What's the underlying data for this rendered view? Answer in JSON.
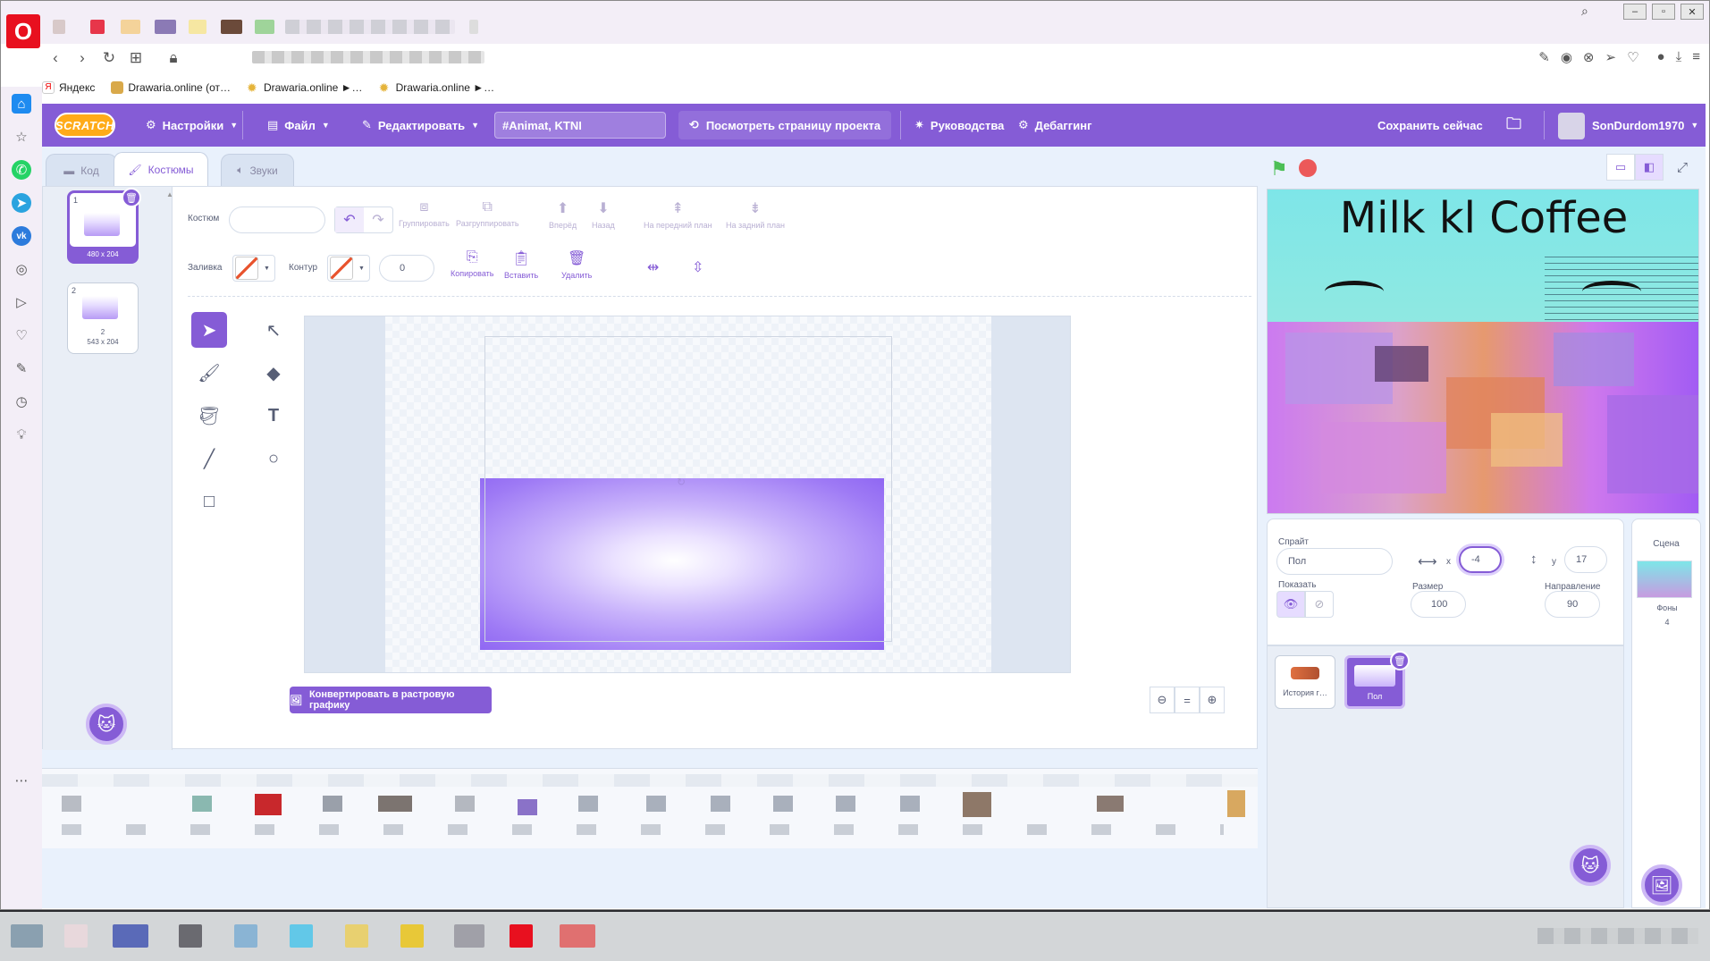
{
  "browser": {
    "logo_letter": "O",
    "window_buttons": [
      "–",
      "▫",
      "✕"
    ],
    "bookmarks": [
      {
        "label": "Яндекс",
        "icon": "yandex-icon"
      },
      {
        "label": "Drawaria.online (от…",
        "icon": "drawaria-icon"
      },
      {
        "label": "Drawaria.online ►…",
        "icon": "sun-icon"
      },
      {
        "label": "Drawaria.online ►…",
        "icon": "sun-icon"
      }
    ]
  },
  "menu": {
    "logo": "SCRATCH",
    "settings": "Настройки",
    "file": "Файл",
    "edit": "Редактировать",
    "project_title": "#Animat, KTNI",
    "view_page": "Посмотреть страницу проекта",
    "tutorials": "Руководства",
    "debugging": "Дебаггинг",
    "save_now": "Сохранить сейчас",
    "username": "SonDurdom1970"
  },
  "tabs": {
    "code": "Код",
    "costumes": "Костюмы",
    "sounds": "Звуки"
  },
  "costumes": [
    {
      "num": "1",
      "name": "",
      "size": "480 x 204",
      "selected": true
    },
    {
      "num": "2",
      "name": "2",
      "size": "543 x 204",
      "selected": false
    }
  ],
  "paint": {
    "costume_label": "Костюм",
    "costume_name": "",
    "fill_label": "Заливка",
    "outline_label": "Контур",
    "outline_width": "0",
    "group": "Группировать",
    "ungroup": "Разгруппировать",
    "forward": "Вперёд",
    "backward": "Назад",
    "front": "На передний план",
    "back": "На задний план",
    "copy": "Копировать",
    "paste": "Вставить",
    "delete": "Удалить",
    "convert": "Конвертировать в растровую графику",
    "zoom_reset": "="
  },
  "stage": {
    "title_text": "Milk kl Coffee"
  },
  "sprite": {
    "sprite_label": "Спрайт",
    "name": "Пол",
    "x_label": "x",
    "x_value": "-4",
    "y_label": "y",
    "y_value": "17",
    "show_label": "Показать",
    "size_label": "Размер",
    "size_value": "100",
    "direction_label": "Направление",
    "direction_value": "90"
  },
  "sprites": [
    {
      "name": "История г…",
      "selected": false
    },
    {
      "name": "Пол",
      "selected": true
    }
  ],
  "scene": {
    "label": "Сцена",
    "backdrops_label": "Фоны",
    "backdrops_count": "4"
  },
  "colors": {
    "scratch_purple": "#855cd6",
    "menu_bar": "#855cd6",
    "green_flag": "#4cbf56",
    "stop": "#ec5959",
    "opera_red": "#e8101f"
  }
}
